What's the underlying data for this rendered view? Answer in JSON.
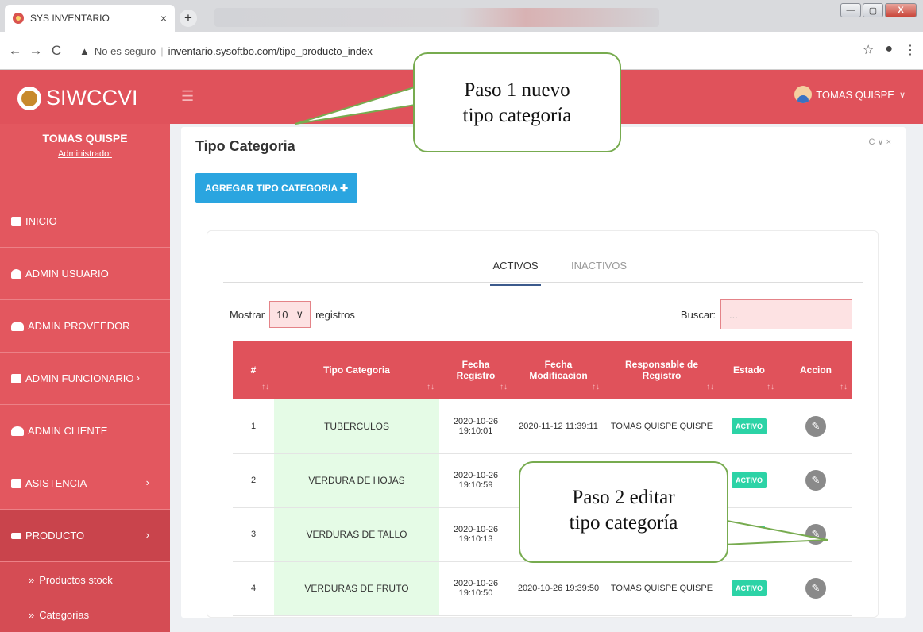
{
  "browser": {
    "tab_title": "SYS INVENTARIO",
    "tab_close": "×",
    "new_tab": "+",
    "security_warning": "No es seguro",
    "url": "inventario.sysoftbo.com/tipo_producto_index",
    "window_controls": [
      "—",
      "▢",
      "X"
    ]
  },
  "header": {
    "brand": "SIWCCVI",
    "user_name": "TOMAS QUISPE",
    "accent_color": "#e0525b"
  },
  "sidebar": {
    "profile_name": "TOMAS QUISPE",
    "profile_role": "Administrador",
    "items": [
      {
        "label": "INICIO",
        "icon": "home-icon"
      },
      {
        "label": "ADMIN USUARIO",
        "icon": "user-icon"
      },
      {
        "label": "ADMIN PROVEEDOR",
        "icon": "users-icon"
      },
      {
        "label": "ADMIN FUNCIONARIO",
        "icon": "briefcase-icon",
        "chevron": "›"
      },
      {
        "label": "ADMIN CLIENTE",
        "icon": "add-user-icon"
      },
      {
        "label": "ASISTENCIA",
        "icon": "calendar-icon",
        "chevron": "›"
      },
      {
        "label": "PRODUCTO",
        "icon": "key-icon",
        "chevron": "›"
      }
    ],
    "subitems": [
      {
        "label": "Productos stock"
      },
      {
        "label": "Categorias"
      }
    ]
  },
  "panel": {
    "title": "Tipo Categoria",
    "tools": "C ∨ ×",
    "add_button": "AGREGAR TIPO CATEGORIA ✚",
    "tabs": {
      "active": "ACTIVOS",
      "inactive": "INACTIVOS"
    },
    "length": {
      "before": "Mostrar",
      "value": "10",
      "after": "registros"
    },
    "search": {
      "label": "Buscar:",
      "placeholder": "..."
    }
  },
  "table": {
    "columns": [
      "#",
      "Tipo Categoria",
      "Fecha Registro",
      "Fecha Modificacion",
      "Responsable de Registro",
      "Estado",
      "Accion"
    ],
    "sort_glyph": "↑↓",
    "rows": [
      {
        "num": "1",
        "tipo": "TUBERCULOS",
        "reg_date": "2020-10-26",
        "reg_time": "19:10:01",
        "mod": "2020-11-12 11:39:11",
        "resp": "TOMAS QUISPE QUISPE",
        "estado": "ACTIVO"
      },
      {
        "num": "2",
        "tipo": "VERDURA DE HOJAS",
        "reg_date": "2020-10-26",
        "reg_time": "19:10:59",
        "mod": "",
        "resp": "",
        "estado": "ACTIVO"
      },
      {
        "num": "3",
        "tipo": "VERDURAS DE TALLO",
        "reg_date": "2020-10-26",
        "reg_time": "19:10:13",
        "mod": "",
        "resp": "",
        "estado": ""
      },
      {
        "num": "4",
        "tipo": "VERDURAS DE FRUTO",
        "reg_date": "2020-10-26",
        "reg_time": "19:10:50",
        "mod": "2020-10-26 19:39:50",
        "resp": "TOMAS QUISPE QUISPE",
        "estado": "ACTIVO"
      }
    ]
  },
  "callouts": {
    "step1": [
      "Paso 1 nuevo",
      "tipo categoría"
    ],
    "step2": [
      "Paso 2 editar",
      "tipo categoría"
    ]
  }
}
